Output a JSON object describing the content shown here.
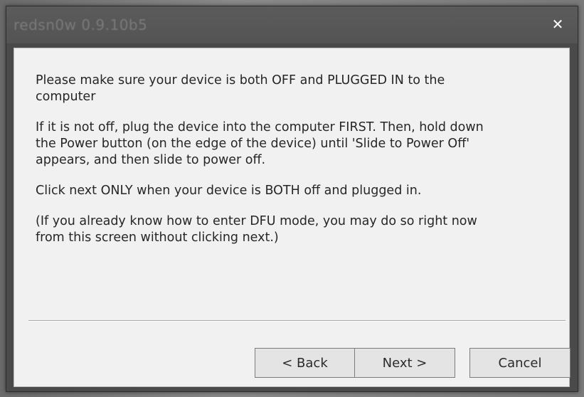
{
  "window": {
    "title": "redsn0w 0.9.10b5",
    "close_glyph": "✕"
  },
  "message": {
    "paragraphs": [
      "Please make sure your device is both OFF and PLUGGED IN to the computer",
      "If it is not off, plug the device into the computer FIRST. Then, hold down the Power button (on the edge of the device) until 'Slide to Power Off' appears, and then slide to power off.",
      "Click next ONLY when your device is BOTH off and plugged in.",
      "(If you already know how to enter DFU mode, you may do so right now from this screen without clicking next.)"
    ]
  },
  "buttons": {
    "back_label": "< Back",
    "next_label": "Next >",
    "cancel_label": "Cancel"
  },
  "colors": {
    "titlebar": "#575757",
    "client": "#f1f1f1",
    "text": "#262626",
    "button_face": "#e4e4e4"
  }
}
